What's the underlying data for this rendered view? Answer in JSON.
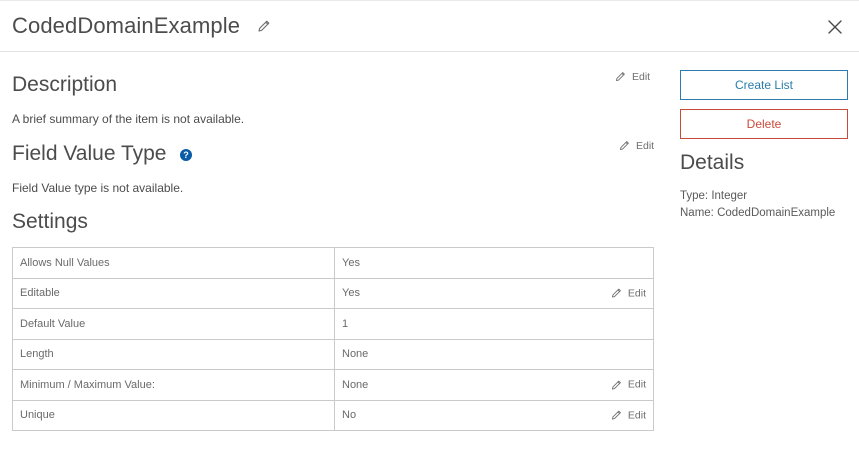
{
  "header": {
    "title": "CodedDomainExample"
  },
  "description": {
    "heading": "Description",
    "edit_label": "Edit",
    "text": "A brief summary of the item is not available."
  },
  "field_value_type": {
    "heading": "Field Value Type",
    "help_glyph": "?",
    "edit_label": "Edit",
    "text": "Field Value type is not available."
  },
  "settings": {
    "heading": "Settings",
    "rows": [
      {
        "label": "Allows Null Values",
        "value": "Yes",
        "edit_label": ""
      },
      {
        "label": "Editable",
        "value": "Yes",
        "edit_label": "Edit"
      },
      {
        "label": "Default Value",
        "value": "1",
        "edit_label": ""
      },
      {
        "label": "Length",
        "value": "None",
        "edit_label": ""
      },
      {
        "label": "Minimum / Maximum Value:",
        "value": "None",
        "edit_label": "Edit"
      },
      {
        "label": "Unique",
        "value": "No",
        "edit_label": "Edit"
      }
    ]
  },
  "sidebar": {
    "create_list_label": "Create List",
    "delete_label": "Delete",
    "details_heading": "Details",
    "type_line": "Type: Integer",
    "name_line": "Name: CodedDomainExample"
  },
  "colors": {
    "accent": "#2b7cad",
    "danger": "#c94a3b",
    "help_icon": "#0b5ca8"
  },
  "icons": [
    "pencil-icon",
    "close-icon",
    "help-icon"
  ]
}
